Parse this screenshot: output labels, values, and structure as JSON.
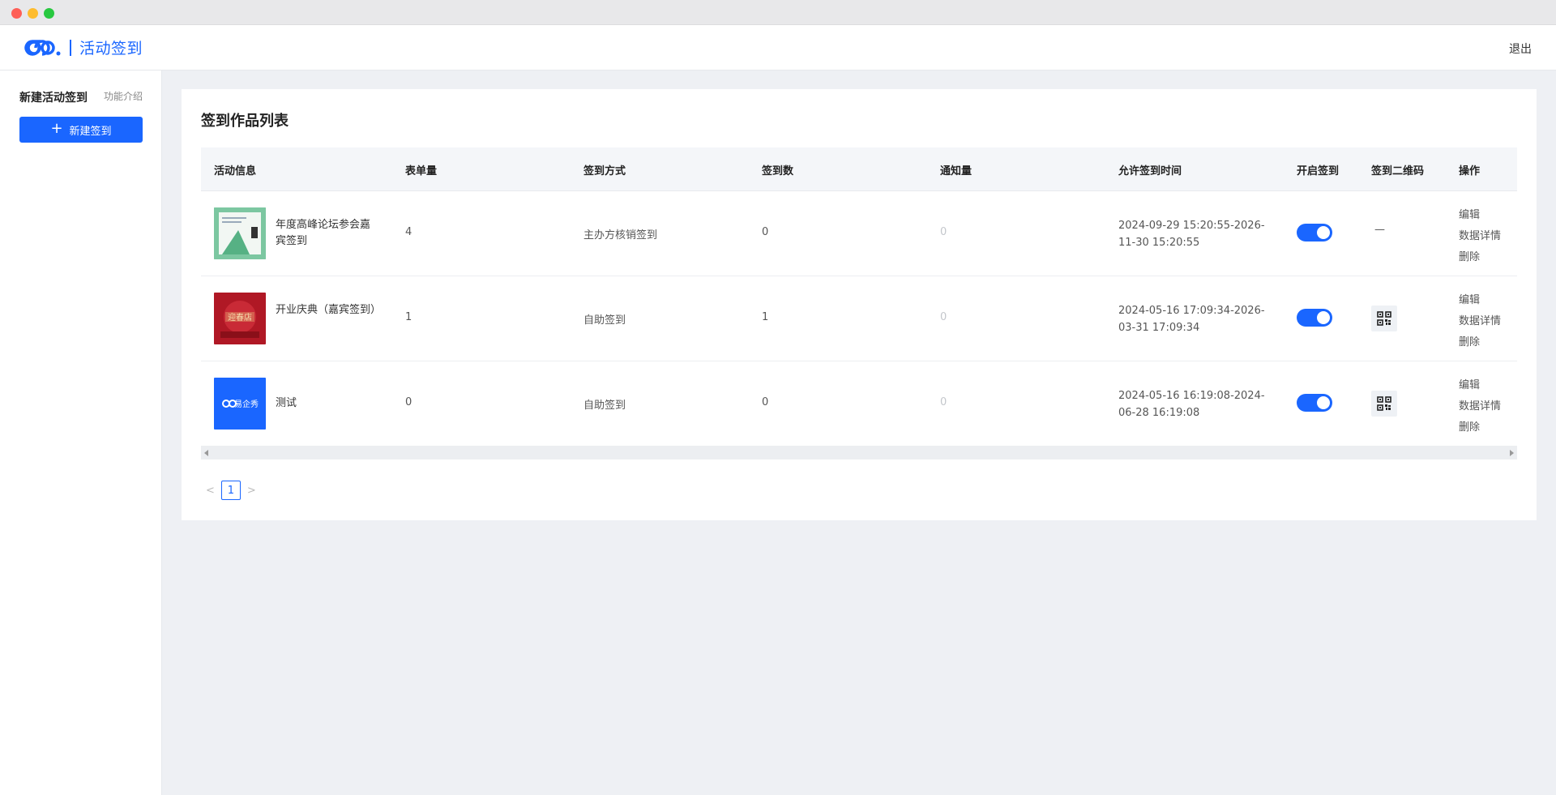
{
  "app": {
    "title": "活动签到",
    "logout": "退出"
  },
  "sidebar": {
    "heading": "新建活动签到",
    "intro_link": "功能介绍",
    "new_button": "新建签到"
  },
  "main": {
    "title": "签到作品列表",
    "columns": [
      "活动信息",
      "表单量",
      "签到方式",
      "签到数",
      "通知量",
      "允许签到时间",
      "开启签到",
      "签到二维码",
      "操作"
    ],
    "rows": [
      {
        "name": "年度高峰论坛参会嘉宾签到",
        "forms": "4",
        "method": "主办方核销签到",
        "signins": "0",
        "notices": "0",
        "time": "2024-09-29 15:20:55-2026-11-30 15:20:55",
        "enabled": true,
        "qr": "—",
        "thumb": "green"
      },
      {
        "name": "开业庆典（嘉宾签到）",
        "forms": "1",
        "method": "自助签到",
        "signins": "1",
        "notices": "0",
        "time": "2024-05-16 17:09:34-2026-03-31 17:09:34",
        "enabled": true,
        "qr": "qr-code-icon",
        "thumb": "red"
      },
      {
        "name": "测试",
        "forms": "0",
        "method": "自助签到",
        "signins": "0",
        "notices": "0",
        "time": "2024-05-16 16:19:08-2024-06-28 16:19:08",
        "enabled": true,
        "qr": "qr-code-icon",
        "thumb": "blue"
      }
    ],
    "ops": [
      "编辑",
      "数据详情",
      "删除"
    ]
  },
  "thumb_text": {
    "red": "迎春店",
    "blue": "易企秀"
  },
  "pager": {
    "prev": "<",
    "page": "1",
    "next": ">"
  },
  "colors": {
    "accent": "#1a66ff"
  }
}
